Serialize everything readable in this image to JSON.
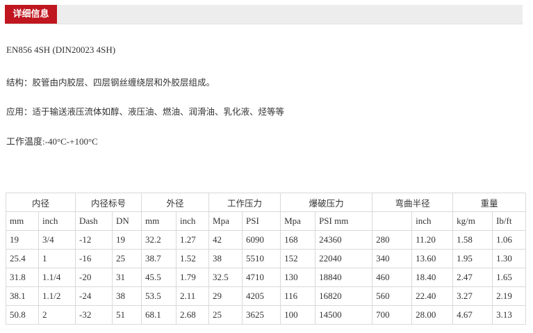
{
  "header": {
    "tab_label": "详细信息"
  },
  "info": {
    "model": "EN856 4SH (DIN20023 4SH)",
    "structure": "结构：胶管由内胶层、四层钢丝缠绕层和外胶层组成。",
    "application": "应用：适于输送液压流体如醇、液压油、燃油、润滑油、乳化液、烃等等",
    "temperature": "工作温度:-40°C-+100°C"
  },
  "table": {
    "groups": [
      "内径",
      "内径标号",
      "外径",
      "工作压力",
      "爆破压力",
      "弯曲半径",
      "重量"
    ],
    "units": [
      "mm",
      "inch",
      "Dash",
      "DN",
      "mm",
      "inch",
      "Mpa",
      "PSI",
      "Mpa",
      "PSI mm",
      "",
      "inch",
      "kg/m",
      "Ib/ft"
    ],
    "rows": [
      [
        "19",
        "3/4",
        "-12",
        "19",
        "32.2",
        "1.27",
        "42",
        "6090",
        "168",
        "24360",
        "280",
        "11.20",
        "1.58",
        "1.06"
      ],
      [
        "25.4",
        "1",
        "-16",
        "25",
        "38.7",
        "1.52",
        "38",
        "5510",
        "152",
        "22040",
        "340",
        "13.60",
        "1.95",
        "1.30"
      ],
      [
        "31.8",
        "1.1/4",
        "-20",
        "31",
        "45.5",
        "1.79",
        "32.5",
        "4710",
        "130",
        "18840",
        "460",
        "18.40",
        "2.47",
        "1.65"
      ],
      [
        "38.1",
        "1.1/2",
        "-24",
        "38",
        "53.5",
        "2.11",
        "29",
        "4205",
        "116",
        "16820",
        "560",
        "22.40",
        "3.27",
        "2.19"
      ],
      [
        "50.8",
        "2",
        "-32",
        "51",
        "68.1",
        "2.68",
        "25",
        "3625",
        "100",
        "14500",
        "700",
        "28.00",
        "4.67",
        "3.13"
      ]
    ]
  }
}
